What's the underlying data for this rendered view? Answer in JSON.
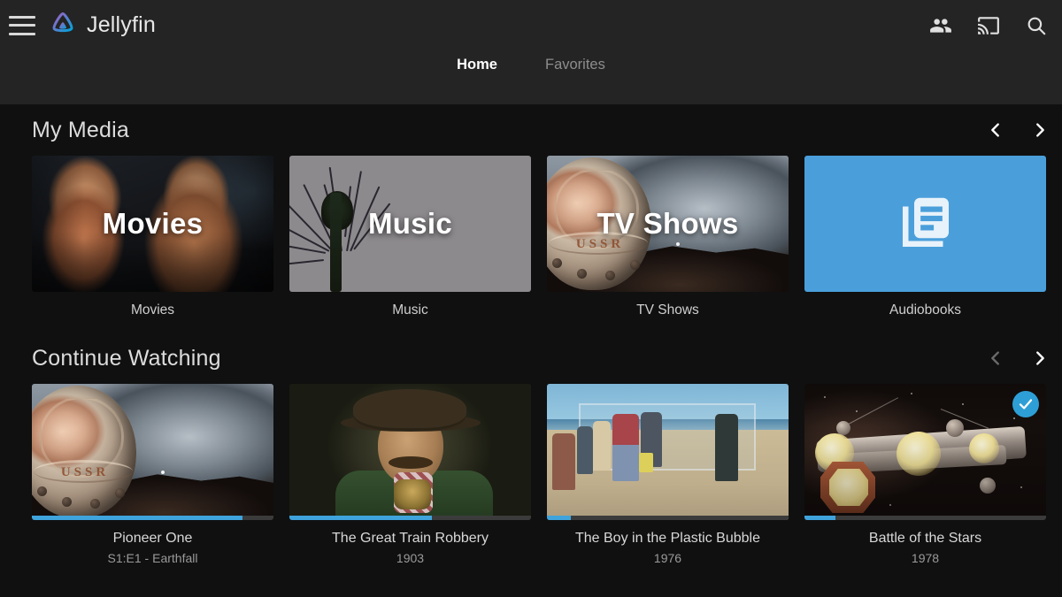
{
  "app": {
    "name": "Jellyfin",
    "logo_gradient_from": "#AA5CC3",
    "logo_gradient_to": "#00A4DC"
  },
  "header": {
    "menu_icon": "hamburger-menu-icon",
    "icons": [
      {
        "name": "user-group-icon",
        "label": "Users"
      },
      {
        "name": "cast-icon",
        "label": "Cast"
      },
      {
        "name": "search-icon",
        "label": "Search"
      }
    ],
    "tabs": [
      {
        "label": "Home",
        "active": true
      },
      {
        "label": "Favorites",
        "active": false
      }
    ]
  },
  "sections": [
    {
      "title": "My Media",
      "prev_enabled": true,
      "next_enabled": true,
      "cards": [
        {
          "overlay_title": "Movies",
          "label": "Movies",
          "art": "art-movies"
        },
        {
          "overlay_title": "Music",
          "label": "Music",
          "art": "art-music"
        },
        {
          "overlay_title": "TV Shows",
          "label": "TV Shows",
          "art": "art-space"
        },
        {
          "overlay_title": "",
          "label": "Audiobooks",
          "art": "solid-blue",
          "tile_color": "#4a9fdb",
          "icon": "library-books-icon"
        }
      ]
    },
    {
      "title": "Continue Watching",
      "prev_enabled": false,
      "next_enabled": true,
      "cards": [
        {
          "label": "Pioneer One",
          "sub": "S1:E1 - Earthfall",
          "progress": 87,
          "watched": false,
          "art": "art-space"
        },
        {
          "label": "The Great Train Robbery",
          "sub": "1903",
          "progress": 59,
          "watched": false,
          "art": "art-train"
        },
        {
          "label": "The Boy in the Plastic Bubble",
          "sub": "1976",
          "progress": 10,
          "watched": false,
          "art": "art-beach"
        },
        {
          "label": "Battle of the Stars",
          "sub": "1978",
          "progress": 13,
          "watched": true,
          "art": "art-ship"
        }
      ]
    }
  ],
  "colors": {
    "header_bg": "#242424",
    "body_bg": "#101010",
    "accent": "#00a4dc",
    "progress_fill": "#3fa3dc",
    "progress_track": "#3b3b3b",
    "badge_bg": "#2e9fd6"
  }
}
